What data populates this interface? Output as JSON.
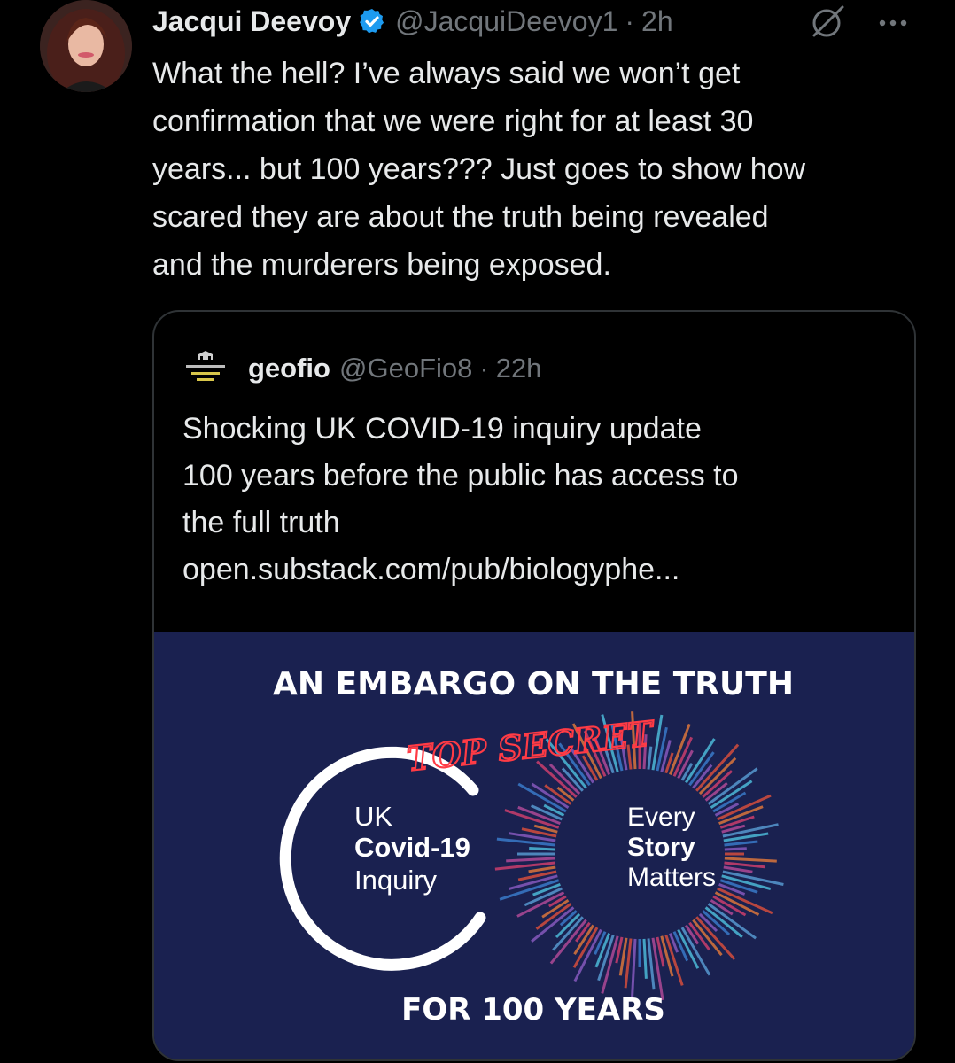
{
  "tweet": {
    "author_name": "Jacqui Deevoy",
    "handle": "@JacquiDeevoy1",
    "separator": "·",
    "time": "2h",
    "more_label": "···",
    "text_lines": [
      "What the hell? I’ve always said we won’t get",
      "confirmation that we were right for at least 30",
      "years... but 100 years??? Just goes to show how",
      "scared they are about the truth being revealed",
      "and the murderers being exposed."
    ]
  },
  "quote": {
    "author_name": "geofio",
    "handle": "@GeoFio8",
    "separator": "·",
    "time": "22h",
    "text_lines": [
      "Shocking UK COVID-19 inquiry update",
      "100 years before the public has access to",
      "the full truth",
      "open.substack.com/pub/biologyphe..."
    ],
    "image": {
      "headline": "AN EMBARGO ON THE TRUTH",
      "stamp": "TOP SECRET",
      "logo_line1": "UK",
      "logo_line2": "Covid-19",
      "logo_line3": "Inquiry",
      "story_line1": "Every",
      "story_line2": "Story",
      "story_line3": "Matters",
      "footer": "FOR 100 YEARS"
    }
  },
  "colors": {
    "background": "#000000",
    "text": "#e7e9ea",
    "muted": "#71767b",
    "verified": "#1d9bf0",
    "border": "#2f3336",
    "image_bg": "#1a2150",
    "stamp": "#e02530"
  },
  "icons": [
    "verified-badge-icon",
    "grok-icon",
    "more-options-icon"
  ]
}
